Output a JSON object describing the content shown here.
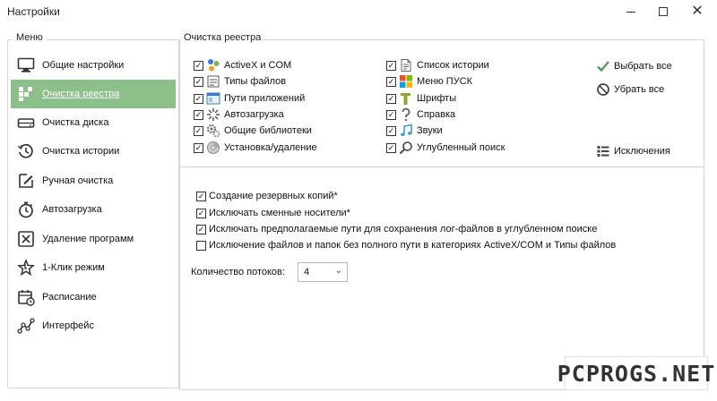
{
  "window": {
    "title": "Настройки"
  },
  "menu": {
    "legend": "Меню",
    "items": [
      {
        "label": "Общие настройки",
        "icon": "monitor-icon"
      },
      {
        "label": "Очистка реестра",
        "icon": "registry-icon",
        "active": true
      },
      {
        "label": "Очистка диска",
        "icon": "disk-icon"
      },
      {
        "label": "Очистка истории",
        "icon": "history-icon"
      },
      {
        "label": "Ручная очистка",
        "icon": "pencil-icon"
      },
      {
        "label": "Автозагрузка",
        "icon": "stopwatch-icon"
      },
      {
        "label": "Удаление программ",
        "icon": "uninstall-icon"
      },
      {
        "label": "1-Клик режим",
        "icon": "star-icon"
      },
      {
        "label": "Расписание",
        "icon": "calendar-icon"
      },
      {
        "label": "Интерфейс",
        "icon": "interface-icon"
      }
    ]
  },
  "registry": {
    "legend": "Очистка реестра",
    "left_categories": [
      {
        "label": "ActiveX и COM",
        "checked": true,
        "icon": "activex-icon"
      },
      {
        "label": "Типы файлов",
        "checked": true,
        "icon": "file-types-icon"
      },
      {
        "label": "Пути приложений",
        "checked": true,
        "icon": "app-paths-icon"
      },
      {
        "label": "Автозагрузка",
        "checked": true,
        "icon": "startup-icon"
      },
      {
        "label": "Общие библиотеки",
        "checked": true,
        "icon": "libraries-icon"
      },
      {
        "label": "Установка/удаление",
        "checked": true,
        "icon": "install-icon"
      }
    ],
    "right_categories": [
      {
        "label": "Список истории",
        "checked": true,
        "icon": "history-list-icon"
      },
      {
        "label": "Меню ПУСК",
        "checked": true,
        "icon": "start-menu-icon"
      },
      {
        "label": "Шрифты",
        "checked": true,
        "icon": "fonts-icon"
      },
      {
        "label": "Справка",
        "checked": true,
        "icon": "help-icon"
      },
      {
        "label": "Звуки",
        "checked": true,
        "icon": "sounds-icon"
      },
      {
        "label": "Углубленный поиск",
        "checked": true,
        "icon": "deep-search-icon"
      }
    ],
    "select_all": "Выбрать все",
    "deselect_all": "Убрать все",
    "exclusions": "Исключения",
    "options": [
      {
        "label": "Создание резервных копий*",
        "checked": true
      },
      {
        "label": "Исключать сменные носители*",
        "checked": true
      },
      {
        "label": "Исключать предполагаемые пути для сохранения лог-файлов в углубленном поиске",
        "checked": true
      },
      {
        "label": "Исключение файлов и папок без полного пути в категориях ActiveX/COM и Типы файлов",
        "checked": false
      }
    ],
    "threads_label": "Количество потоков:",
    "threads_value": "4"
  },
  "watermark": "PCPROGS.NET",
  "colors": {
    "active_menu_bg": "#8dbf8a",
    "select_check": "#4aa34a"
  }
}
